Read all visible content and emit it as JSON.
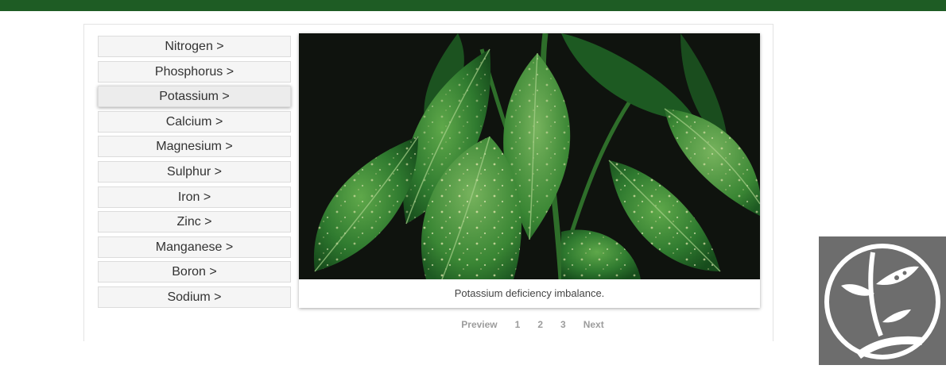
{
  "nutrients": [
    {
      "label": "Nitrogen >"
    },
    {
      "label": "Phosphorus >"
    },
    {
      "label": "Potassium >"
    },
    {
      "label": "Calcium >"
    },
    {
      "label": "Magnesium >"
    },
    {
      "label": "Sulphur >"
    },
    {
      "label": "Iron >"
    },
    {
      "label": "Zinc >"
    },
    {
      "label": "Manganese >"
    },
    {
      "label": "Boron >"
    },
    {
      "label": "Sodium >"
    }
  ],
  "active_nutrient": "Potassium >",
  "figure": {
    "caption": "Potassium deficiency imbalance.",
    "image_icon": "leaf-photo"
  },
  "pagination": {
    "prev": "Preview",
    "pages": [
      "1",
      "2",
      "3"
    ],
    "next": "Next"
  },
  "colors": {
    "topbar": "#1e5c24",
    "logo_bg": "#6d6d6d"
  },
  "logo_icon": "plant-logo-icon"
}
